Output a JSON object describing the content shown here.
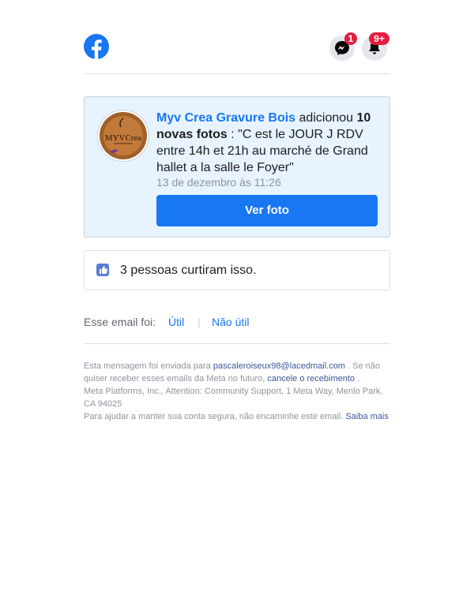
{
  "header": {
    "messenger_badge": "1",
    "notifications_badge": "9+"
  },
  "notification": {
    "page_name": "Myv Crea Gravure Bois",
    "action": "adicionou",
    "count_label": "10 novas fotos",
    "caption": ": \"C est le JOUR J RDV entre 14h et 21h au marché de Grand hallet a la salle le Foyer\"",
    "timestamp": "13 de dezembro às 11:26",
    "button_label": "Ver foto"
  },
  "likes": {
    "text": "3 pessoas curtiram isso."
  },
  "feedback": {
    "prompt": "Esse email foi:",
    "useful": "Útil",
    "separator": "|",
    "not_useful": "Não útil"
  },
  "footer": {
    "sent_to_prefix": "Esta mensagem foi enviada para",
    "email": "pascaleroiseux98@lacedmail.com",
    "unsub_prefix": ". Se não quiser receber esses emails da Meta no futuro,",
    "unsub_link": "cancele o recebimento",
    "unsub_suffix": ".",
    "address": "Meta Platforms, Inc., Attention: Community Support, 1 Meta Way, Menlo Park, CA 94025",
    "security_text": "Para ajudar a manter sua conta segura, não encaminhe este email.",
    "learn_more": "Saiba mais"
  },
  "colors": {
    "brand": "#1877f2",
    "badge": "#e41e3f",
    "card_bg": "#e7f3ff"
  }
}
